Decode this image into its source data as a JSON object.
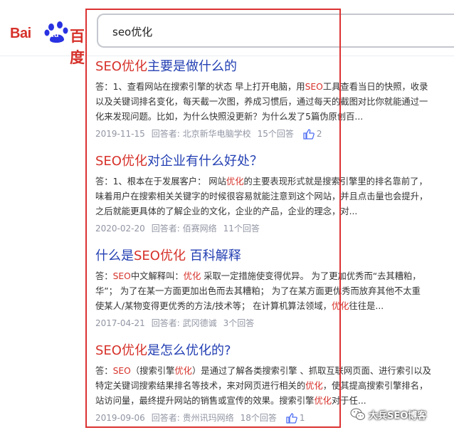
{
  "header": {
    "logo_text_latin": "Bai",
    "logo_paw_text": "du",
    "logo_text_cn": "百度",
    "search_query": "seo优化"
  },
  "results": [
    {
      "title_em": "SEO优化",
      "title_rest": "主要是做什么的",
      "lines": [
        [
          [
            "答：1、查看网站在搜索引擎的状态 早上打开电脑，用",
            ""
          ],
          [
            "SEO",
            "em"
          ],
          [
            "工具查看当日的快照，收录",
            ""
          ]
        ],
        [
          [
            "以及关键词排名变化，每天截一次图，养成习惯后，通过每天的截图对比你就能通过一",
            ""
          ]
        ],
        [
          [
            "化来发现问题。比如，为什么快照没更新？为什么发了5篇伪原创百...",
            ""
          ]
        ]
      ],
      "date": "2019-11-15",
      "answerer": "回答者: 北京新华电脑学校",
      "answers": "15个回答",
      "likes": "2"
    },
    {
      "title_em": "SEO优化",
      "title_rest": "对企业有什么好处？",
      "lines": [
        [
          [
            "答：1、根本在于发展客户： 网站",
            ""
          ],
          [
            "优化",
            "em"
          ],
          [
            "的主要表现形式就是搜索引擎里的排名靠前了，",
            ""
          ]
        ],
        [
          [
            "味着用户在搜索相关关键字的时候很容易就能注意到这个网站，并且点击量也会提升，",
            ""
          ]
        ],
        [
          [
            "之后就能更具体的了解企业的文化，企业的产品，企业的理念，对...",
            ""
          ]
        ]
      ],
      "date": "2020-02-20",
      "answerer": "回答者: 佰赛网络",
      "answers": "11个回答",
      "likes": ""
    },
    {
      "title_pre": "什么是",
      "title_em": "SEO优化",
      "title_rest": " 百科解释",
      "lines": [
        [
          [
            "答：",
            ""
          ],
          [
            "SEO",
            "em"
          ],
          [
            "中文解释叫：",
            ""
          ],
          [
            "优化",
            "em"
          ],
          [
            " 采取一定措施使变得优异。 为了更加优秀而“去其糟粕，",
            ""
          ]
        ],
        [
          [
            "华”； 为了在某一方面更加出色而去其糟粕； 为了在某方面更优秀而放弃其他不太重",
            ""
          ]
        ],
        [
          [
            "使某人/某物变得更优秀的方法/技术等； 在计算机算法领域，",
            ""
          ],
          [
            "优化",
            "em"
          ],
          [
            "往往是...",
            ""
          ]
        ]
      ],
      "date": "2017-04-21",
      "answerer": "回答者: 武冈德诚",
      "answers": "3个回答",
      "likes": ""
    },
    {
      "title_em": "SEO优化",
      "title_rest": "是怎么优化的?",
      "lines": [
        [
          [
            "答：",
            ""
          ],
          [
            "SEO",
            "em"
          ],
          [
            "（搜索引擎",
            ""
          ],
          [
            "优化",
            "em"
          ],
          [
            "）是通过了解各类搜索引擎 、抓取互联网页面、进行索引以及",
            ""
          ]
        ],
        [
          [
            "特定关键词搜索结果排名等技术，来对网页进行相关的",
            ""
          ],
          [
            "优化",
            "em"
          ],
          [
            "，使其提高搜索引擎排名，",
            ""
          ]
        ],
        [
          [
            "站访问量，最终提升网站的销售或宣传的效果。搜索引擎",
            ""
          ],
          [
            "优化",
            "em"
          ],
          [
            "对于任...",
            ""
          ]
        ]
      ],
      "date": "2019-09-06",
      "answerer": "回答者: 贵州讯玛网络",
      "answers": "18个回答",
      "likes": "1"
    }
  ],
  "watermark": {
    "text": "大兵SEO博客",
    "icon": "wechat-icon"
  },
  "colors": {
    "link": "#2440b3",
    "highlight": "#d6312a",
    "meta": "#9195a3",
    "box": "#dc3232"
  }
}
